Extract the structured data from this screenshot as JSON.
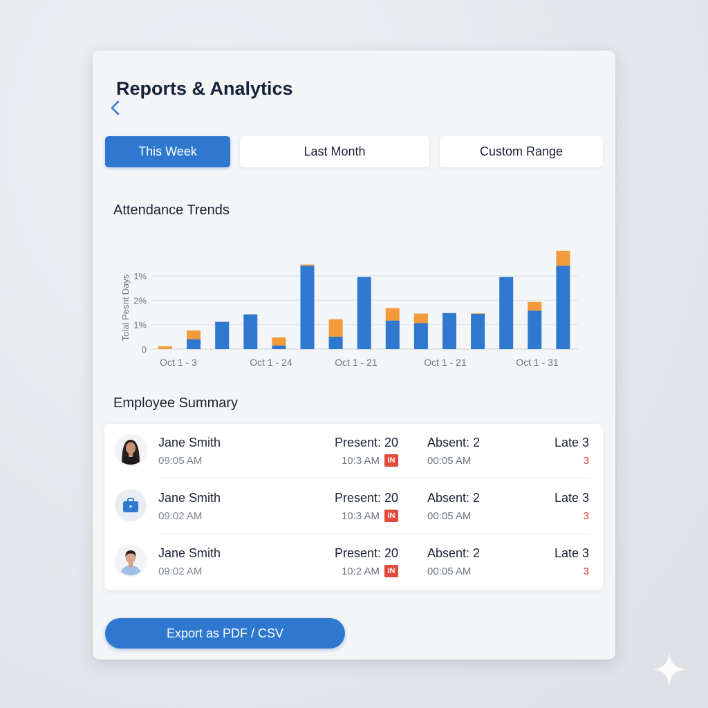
{
  "header": {
    "title": "Reports & Analytics"
  },
  "tabs": [
    {
      "label": "This Week",
      "active": true
    },
    {
      "label": "Last Month",
      "active": false
    },
    {
      "label": "Custom Range",
      "active": false
    }
  ],
  "chart_section": {
    "title": "Attendance Trends"
  },
  "chart_data": {
    "type": "bar",
    "stacked": true,
    "ylabel": "Tolal Pesnt Days",
    "ytick_labels": [
      "0",
      "1%",
      "2%",
      "1%"
    ],
    "xtick_labels": [
      "Oct 1 - 3",
      "Oct 1 - 24",
      "Oct 1 - 21",
      "Oct 1 - 21",
      "Oct 1 - 31"
    ],
    "ylim": [
      0,
      4
    ],
    "grid": true,
    "colors": {
      "base": "#2f78d0",
      "top": "#f39a3a"
    },
    "series": [
      {
        "values": [
          0,
          0.4,
          1.1,
          1.4,
          0.15,
          3.35,
          0.5,
          2.9,
          1.15,
          1.05,
          1.45,
          1.42,
          2.9,
          1.55,
          3.35
        ]
      },
      {
        "values": [
          0.12,
          0.35,
          0,
          0,
          0.32,
          0.05,
          0.7,
          0,
          0.5,
          0.38,
          0,
          0.02,
          0,
          0.35,
          0.6
        ]
      }
    ]
  },
  "summary": {
    "title": "Employee Summary",
    "rows": [
      {
        "avatar": "woman-avatar",
        "name": "Jane Smith",
        "time": "09:05 AM",
        "present": "Present: 20",
        "present_time": "10:3 AM",
        "badge": "IN",
        "absent": "Absent: 2",
        "absent_time": "00:05 AM",
        "late": "Late  3",
        "late_value": "3"
      },
      {
        "avatar": "briefcase-icon",
        "name": "Jane Smith",
        "time": "09:02 AM",
        "present": "Present: 20",
        "present_time": "10:3 AM",
        "badge": "IN",
        "absent": "Absent: 2",
        "absent_time": "00:05 AM",
        "late": "Late  3",
        "late_value": "3"
      },
      {
        "avatar": "man-avatar",
        "name": "Jane Smith",
        "time": "09:02 AM",
        "present": "Present: 20",
        "present_time": "10:2 AM",
        "badge": "IN",
        "absent": "Absent: 2",
        "absent_time": "00:05 AM",
        "late": "Late  3",
        "late_value": "3"
      }
    ]
  },
  "export": {
    "label": "Export as PDF / CSV"
  },
  "colors": {
    "accent": "#2f78d0",
    "orange": "#f39a3a",
    "badge_red": "#e14b3b"
  }
}
